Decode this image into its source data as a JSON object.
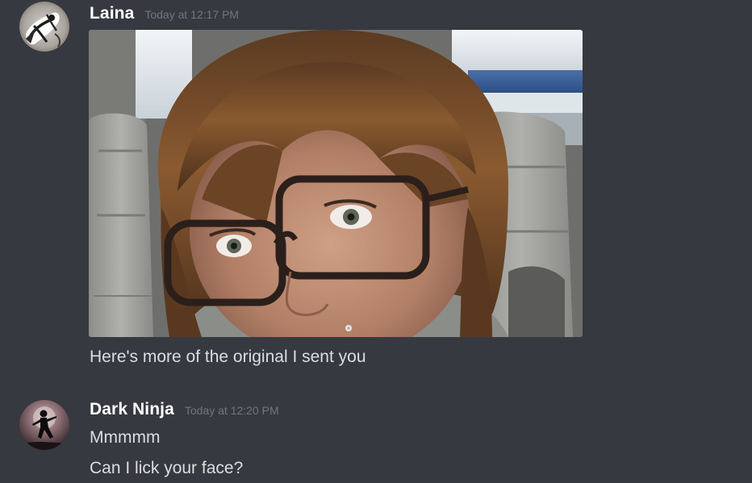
{
  "messages": [
    {
      "author": "Laina",
      "timestamp": "Today at 12:17 PM",
      "avatar_icon": "sketch-avatar",
      "attachment": {
        "type": "image",
        "subject": "selfie"
      },
      "lines": [
        "Here's more of the original I sent you"
      ]
    },
    {
      "author": "Dark Ninja",
      "timestamp": "Today at 12:20 PM",
      "avatar_icon": "ninja-silhouette-avatar",
      "lines": [
        "Mmmmm",
        "Can I lick your face?"
      ]
    }
  ],
  "colors": {
    "background": "#36393f",
    "username": "#ffffff",
    "timestamp": "#72767d",
    "message_text": "#dcddde"
  }
}
